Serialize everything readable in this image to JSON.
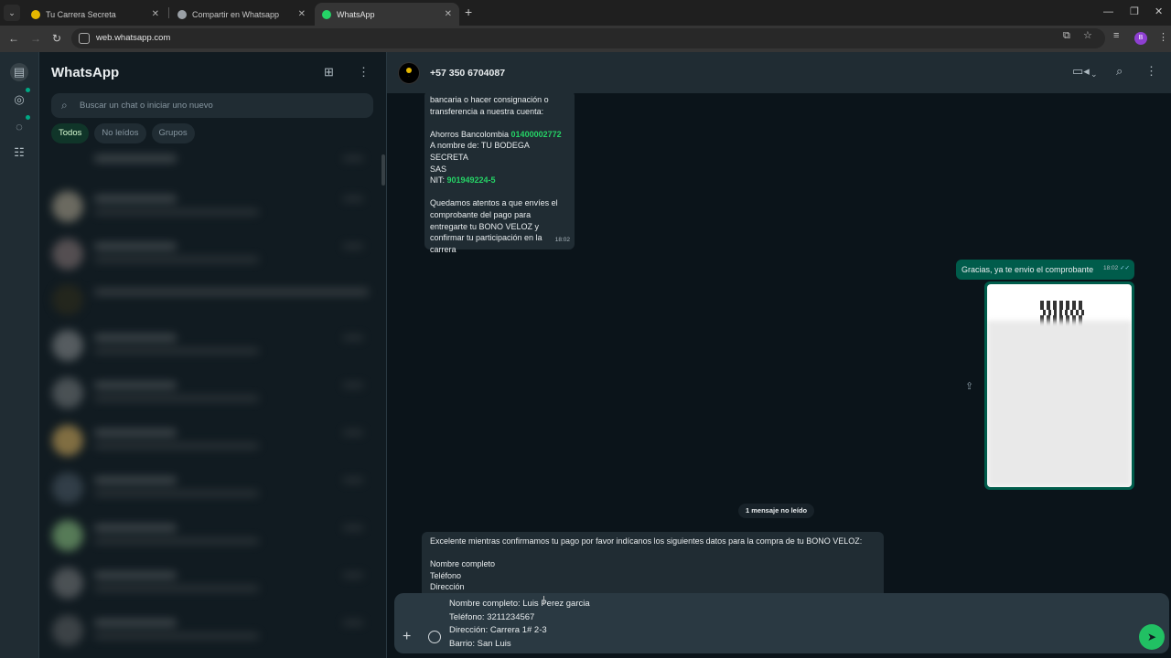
{
  "browser": {
    "tabs": [
      {
        "label": "Tu Carrera Secreta",
        "active": false,
        "favicon_color": "#e6b800"
      },
      {
        "label": "Compartir en Whatsapp",
        "active": false,
        "favicon_color": "#9aa0a6"
      },
      {
        "label": "WhatsApp",
        "active": true,
        "favicon_color": "#25d366"
      }
    ],
    "url": "web.whatsapp.com",
    "profile_initial": "B"
  },
  "sidebar": {
    "app_title": "WhatsApp",
    "search_placeholder": "Buscar un chat o iniciar uno nuevo",
    "filters": [
      {
        "label": "Todos",
        "active": true
      },
      {
        "label": "No leídos",
        "active": false
      },
      {
        "label": "Grupos",
        "active": false
      }
    ]
  },
  "chat": {
    "contact_name": "+57 350 6704087",
    "messages": {
      "incoming_1": {
        "lines_a": [
          "bancaria o hacer consignación o",
          "transferencia a nuestra cuenta:"
        ],
        "account_prefix": "Ahorros Bancolombia ",
        "account_number": "01400002772",
        "owner_line_1": "A nombre de: TU BODEGA SECRETA",
        "owner_line_2": "SAS",
        "nit_prefix": "NIT: ",
        "nit_number": "901949224-5",
        "lines_b": [
          "Quedamos atentos a que envíes el",
          "comprobante del pago para",
          "entregarte tu BONO VELOZ y",
          "confirmar tu participación en la",
          "carrera"
        ],
        "time": "18:02"
      },
      "outgoing_1": {
        "text": "Gracias, ya te envio el comprobante",
        "time": "18:02",
        "ticks": "✓✓"
      },
      "unread_divider": "1 mensaje no leído",
      "incoming_2": {
        "intro": "Excelente mientras confirmamos tu pago por favor indícanos los siguientes datos para la compra de tu BONO VELOZ:",
        "fields": [
          "Nombre completo",
          "Teléfono",
          "Dirección"
        ]
      }
    },
    "composer_lines": [
      "Nombre completo: Luis Perez garcia",
      "Teléfono: 3211234567",
      "Dirección: Carrera 1# 2-3",
      "Barrio: San Luis"
    ]
  },
  "colors": {
    "accent": "#00a884",
    "incoming_bubble": "#202c33",
    "outgoing_bubble": "#005c4b",
    "highlight": "#25d366",
    "send_button": "#21c063"
  }
}
